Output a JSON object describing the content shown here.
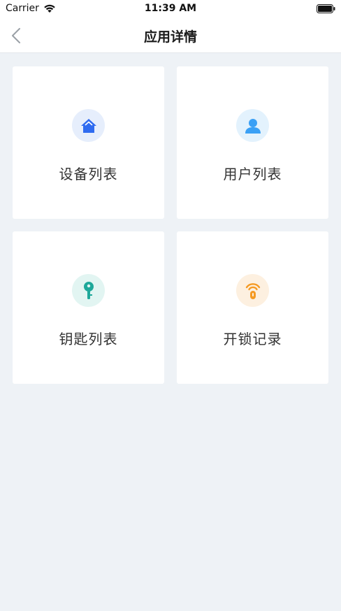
{
  "status_bar": {
    "carrier": "Carrier",
    "time": "11:39 AM"
  },
  "nav": {
    "title": "应用详情",
    "back_icon": "chevron-left-icon"
  },
  "cards": [
    {
      "label": "设备列表",
      "icon": "home-icon",
      "icon_color": "#2f6bf0",
      "bg_color": "#e6eefc"
    },
    {
      "label": "用户列表",
      "icon": "user-icon",
      "icon_color": "#3aa0f5",
      "bg_color": "#e3f2fd"
    },
    {
      "label": "钥匙列表",
      "icon": "key-icon",
      "icon_color": "#1ea89a",
      "bg_color": "#e2f5f2"
    },
    {
      "label": "开锁记录",
      "icon": "unlock-signal-icon",
      "icon_color": "#f59a23",
      "bg_color": "#fdf0e0"
    }
  ],
  "colors": {
    "page_bg": "#eef2f6",
    "card_bg": "#ffffff",
    "nav_bg": "#ffffff"
  }
}
